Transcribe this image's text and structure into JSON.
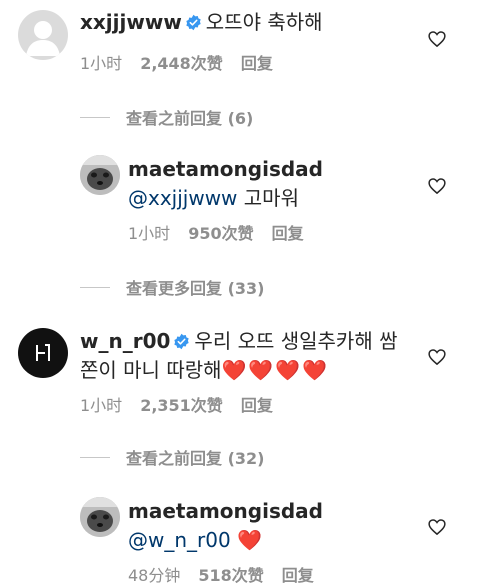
{
  "comments": [
    {
      "username": "xxjjjwww",
      "verified": true,
      "text": "오뜨야 축하해",
      "time": "1小时",
      "likes": "2,448次赞",
      "reply_label": "回复"
    },
    {
      "username": "maetamongisdad",
      "verified": false,
      "mention": "@xxjjjwww",
      "text": "고마워",
      "time": "1小时",
      "likes": "950次赞",
      "reply_label": "回复"
    },
    {
      "username": "w_n_r00",
      "verified": true,
      "text_line1": "우리 오뜨 생일추카해 쌈",
      "text_line2": "쫀이 마니 따랑해",
      "hearts": "❤️❤️❤️❤️",
      "time": "1小时",
      "likes": "2,351次赞",
      "reply_label": "回复"
    },
    {
      "username": "maetamongisdad",
      "verified": false,
      "mention": "@w_n_r00",
      "hearts": "❤️",
      "time": "48分钟",
      "likes": "518次赞",
      "reply_label": "回复"
    }
  ],
  "view_replies": [
    {
      "label": "查看之前回复 (6)"
    },
    {
      "label": "查看更多回复 (33)"
    },
    {
      "label": "查看之前回复 (32)"
    }
  ],
  "colors": {
    "text": "#262626",
    "meta": "#8e8e8e",
    "mention": "#00376b",
    "verified": "#3897f0",
    "heart_red": "#ed1c3a"
  }
}
